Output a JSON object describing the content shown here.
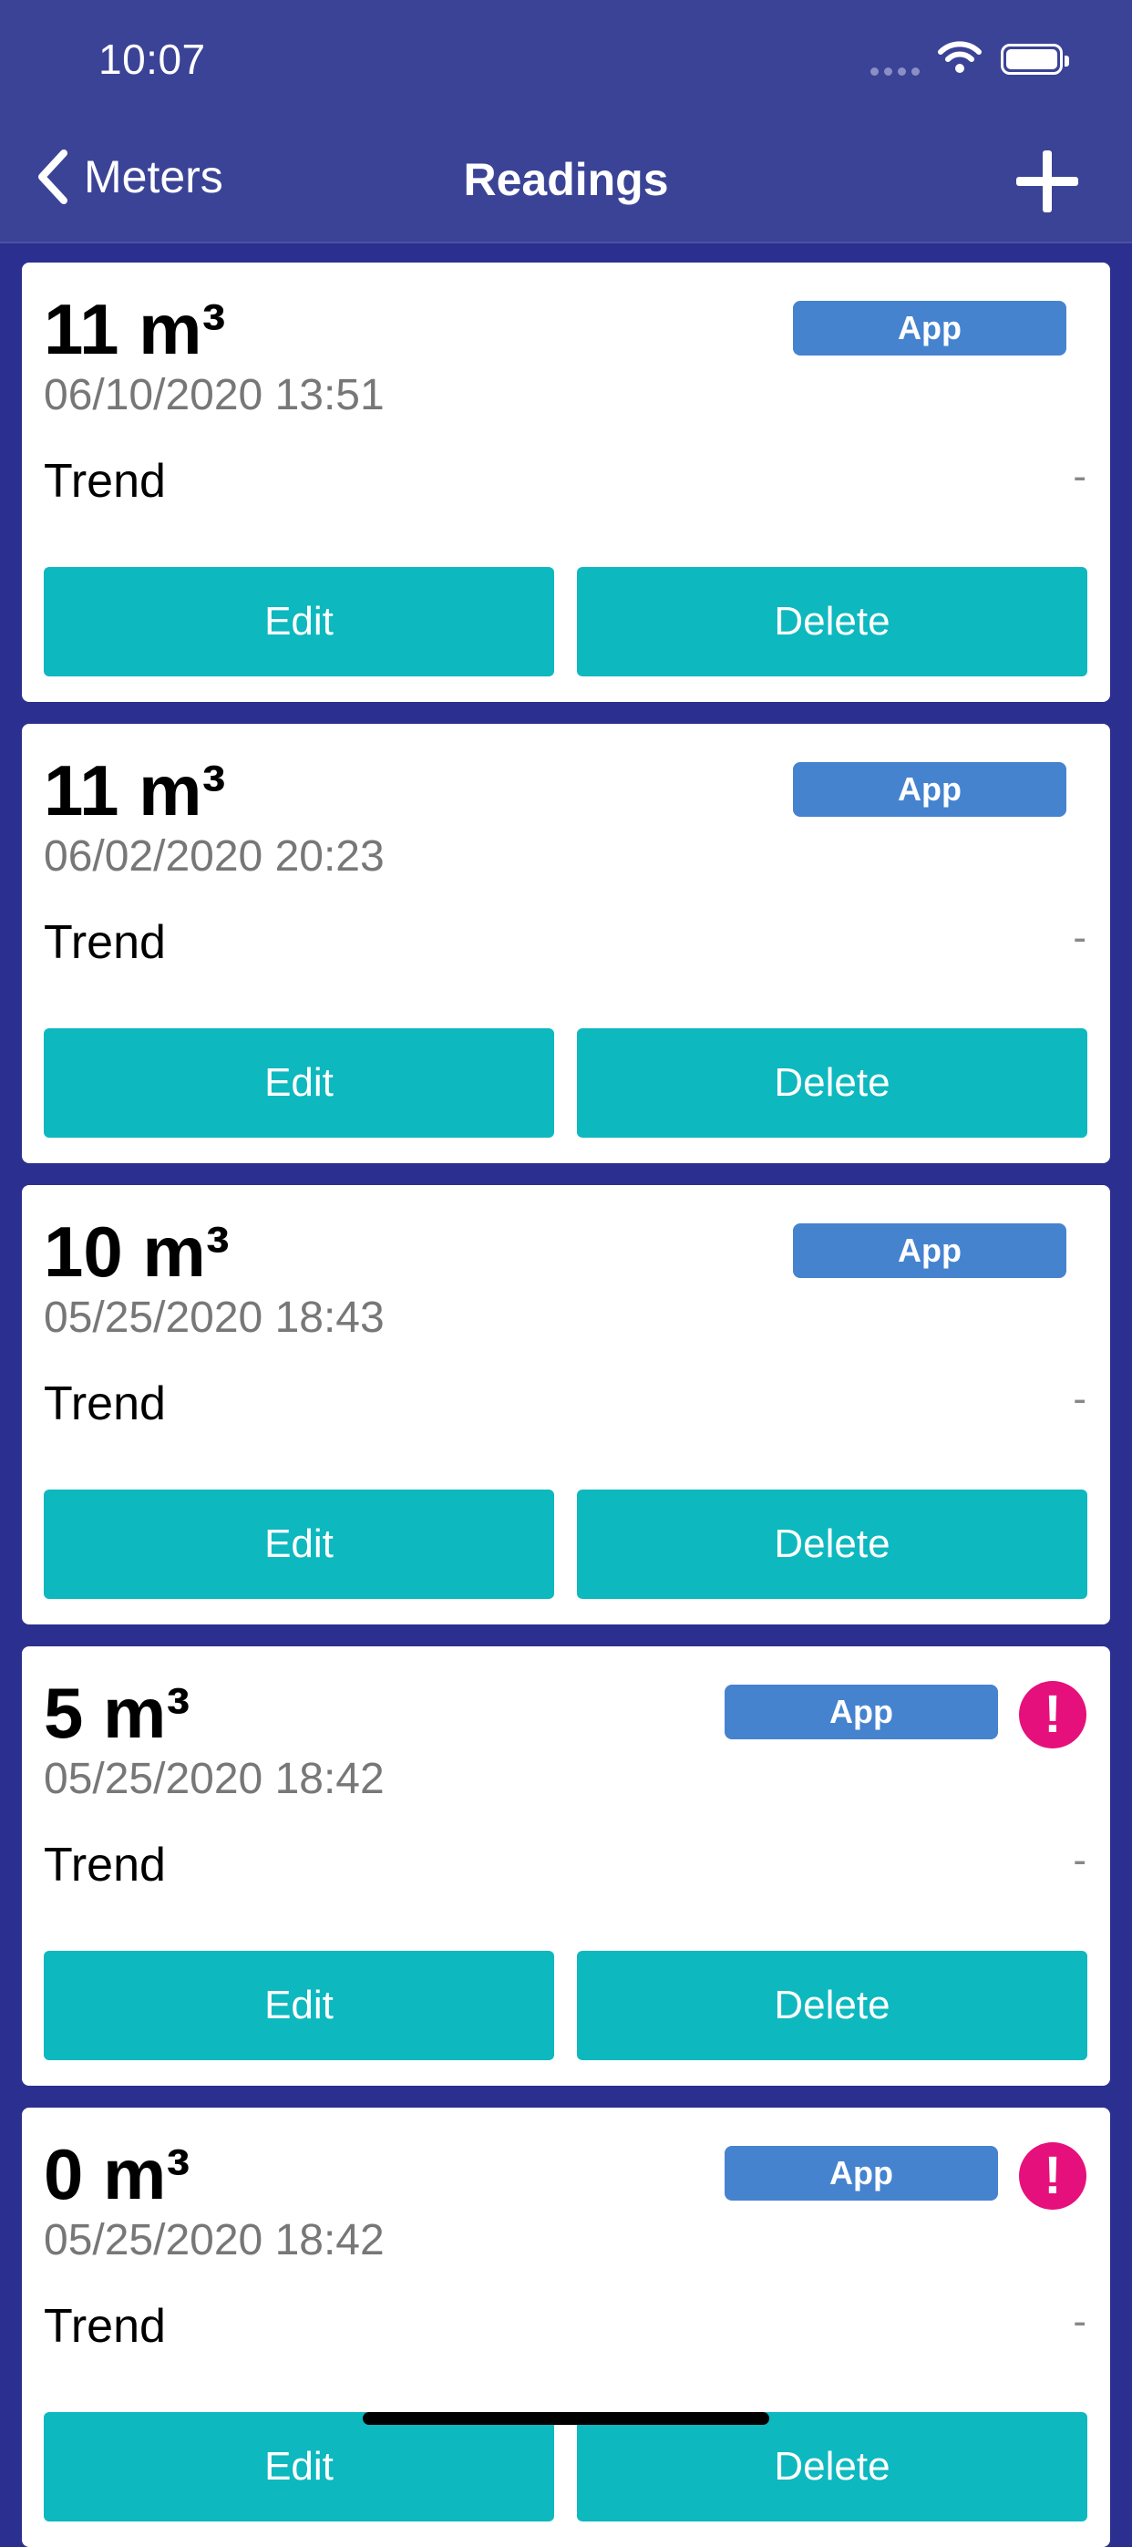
{
  "status_bar": {
    "time": "10:07"
  },
  "nav": {
    "back_label": "Meters",
    "title": "Readings"
  },
  "cards": [
    {
      "value": "11 m³",
      "date": "06/10/2020 13:51",
      "badge": "App",
      "trend_label": "Trend",
      "trend_value": "-",
      "edit_label": "Edit",
      "delete_label": "Delete",
      "alert": ""
    },
    {
      "value": "11 m³",
      "date": "06/02/2020 20:23",
      "badge": "App",
      "trend_label": "Trend",
      "trend_value": "-",
      "edit_label": "Edit",
      "delete_label": "Delete",
      "alert": ""
    },
    {
      "value": "10 m³",
      "date": "05/25/2020 18:43",
      "badge": "App",
      "trend_label": "Trend",
      "trend_value": "-",
      "edit_label": "Edit",
      "delete_label": "Delete",
      "alert": ""
    },
    {
      "value": "5 m³",
      "date": "05/25/2020 18:42",
      "badge": "App",
      "trend_label": "Trend",
      "trend_value": "-",
      "edit_label": "Edit",
      "delete_label": "Delete",
      "alert": "!"
    },
    {
      "value": "0 m³",
      "date": "05/25/2020 18:42",
      "badge": "App",
      "trend_label": "Trend",
      "trend_value": "-",
      "edit_label": "Edit",
      "delete_label": "Delete",
      "alert": "!"
    }
  ],
  "colors": {
    "nav_bg": "#3b4397",
    "page_bg": "#2b2f8f",
    "badge": "#4583cf",
    "button": "#0db8bf",
    "alert": "#e5107b"
  }
}
